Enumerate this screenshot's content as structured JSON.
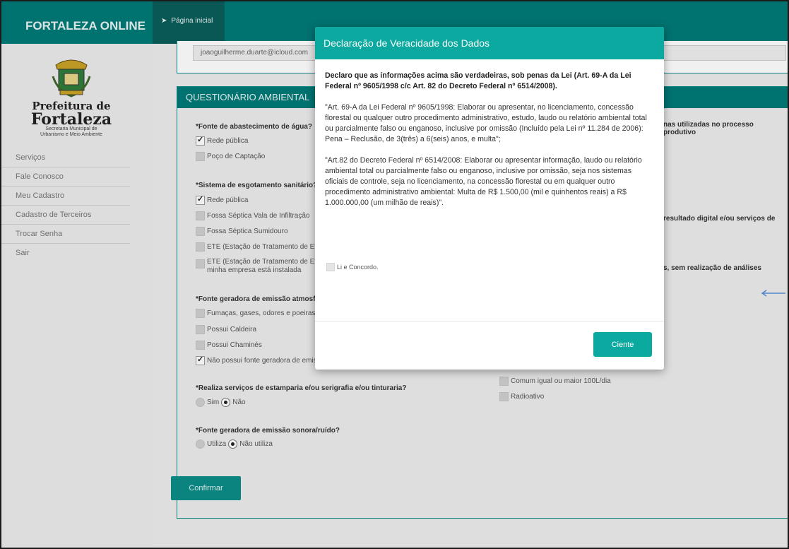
{
  "app": {
    "brand": "FORTALEZA ONLINE",
    "home_tab": "Página inicial",
    "icon": "location-arrow-icon"
  },
  "logo": {
    "title1": "Prefeitura de",
    "title2": "Fortaleza",
    "sub1": "Secretaria Municipal de",
    "sub2": "Urbanismo e Meio Ambiente"
  },
  "sidebar": {
    "items": [
      {
        "label": "Serviços"
      },
      {
        "label": "Fale Conosco"
      },
      {
        "label": "Meu Cadastro"
      },
      {
        "label": "Cadastro de Terceiros"
      },
      {
        "label": "Trocar Senha"
      },
      {
        "label": "Sair"
      }
    ]
  },
  "email": {
    "value": "joaoguilherme.duarte@icloud.com"
  },
  "questionnaire": {
    "header": "QUESTIONÁRIO AMBIENTAL",
    "q_water": "*Fonte de abastecimento de água?",
    "water_opts": [
      {
        "label": "Rede pública",
        "checked": true
      },
      {
        "label": "Poço de Captação",
        "checked": false
      }
    ],
    "q_sewage": "*Sistema de esgotamento sanitário?",
    "sewage_opts": [
      {
        "label": "Rede pública",
        "checked": true
      },
      {
        "label": "Fossa Séptica Vala de Infiltração",
        "checked": false
      },
      {
        "label": "Fossa Séptica Sumidouro",
        "checked": false
      },
      {
        "label": "ETE (Estação de Tratamento de Ef",
        "checked": false
      },
      {
        "label": "ETE (Estação de Tratamento de Ef",
        "label2": "minha empresa está instalada",
        "checked": false
      }
    ],
    "q_atmos": "*Fonte geradora de emissão atmosfér",
    "atmos_opts": [
      {
        "label": "Fumaças, gases, odores e poeiras",
        "checked": false
      },
      {
        "label": "Possui Caldeira",
        "checked": false
      },
      {
        "label": "Possui Chaminés",
        "checked": false
      },
      {
        "label": "Não possui fonte geradora de emis",
        "checked": true
      }
    ],
    "q_print": "*Realiza serviços de estamparia e/ou serigrafia e/ou tinturaria?",
    "print_opts": [
      {
        "label": "Sim",
        "checked": false
      },
      {
        "label": "Não",
        "checked": true
      }
    ],
    "q_noise": "*Fonte geradora de emissão sonora/ruído?",
    "noise_opts": [
      {
        "label": "Utiliza",
        "checked": false
      },
      {
        "label": "Não utiliza",
        "checked": true
      }
    ],
    "right_q1": "nas utilizadas no processo produtivo",
    "right_q2": "resultado digital e/ou serviços de",
    "right_q3": "s, sem realização de análises",
    "right_opts": [
      {
        "label": "Comum igual ou maior 100L/dia"
      },
      {
        "label": "Radioativo"
      }
    ],
    "confirm_label": "Confirmar"
  },
  "modal": {
    "title": "Declaração de Veracidade dos Dados",
    "lead": "Declaro que as informações acima são verdadeiras, sob penas da Lei (Art. 69-A da Lei Federal nº 9605/1998 c/c Art. 82 do Decreto Federal nº 6514/2008).",
    "p1": "\"Art. 69-A da Lei Federal nº 9605/1998: Elaborar ou apresentar, no licenciamento, concessão florestal ou qualquer outro procedimento administrativo, estudo, laudo ou relatório ambiental total ou parcialmente falso ou enganoso, inclusive por omissão (Incluído pela Lei nº 11.284 de 2006): Pena – Reclusão, de 3(três) a 6(seis) anos, e multa\";",
    "p2": "\"Art.82 do Decreto Federal nº 6514/2008: Elaborar ou apresentar informação, laudo ou relatório ambiental total ou parcialmente falso ou enganoso, inclusive por omissão, seja nos sistemas oficiais de controle, seja no licenciamento, na concessão florestal ou em qualquer outro procedimento administrativo ambiental: Multa de R$ 1.500,00 (mil e quinhentos reais) a R$ 1.000.000,00 (um milhão de reais)\".",
    "agree_label": "Li e Concordo.",
    "agree_checked": false,
    "ciente_label": "Ciente"
  },
  "colors": {
    "primary": "#007a78",
    "modal_accent": "#0ba99f",
    "sidebar_bg": "#ebebeb"
  }
}
